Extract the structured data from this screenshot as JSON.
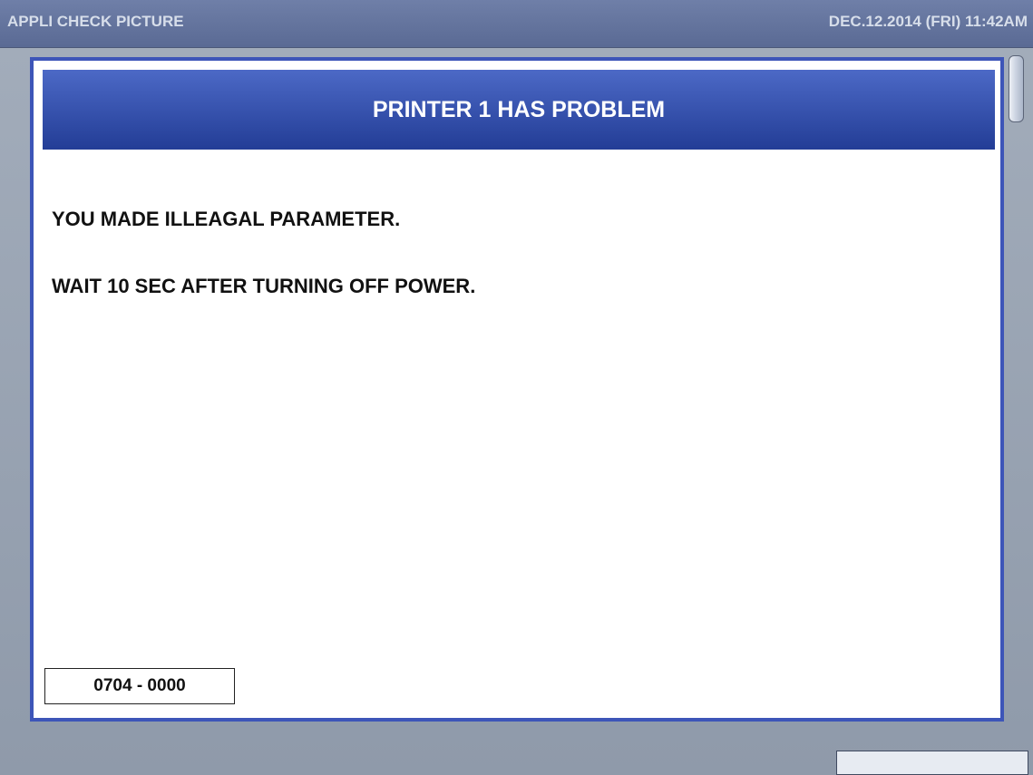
{
  "header": {
    "title": "APPLI CHECK PICTURE",
    "datetime": "DEC.12.2014 (FRI)  11:42AM"
  },
  "dialog": {
    "title": "PRINTER 1 HAS PROBLEM",
    "messages": [
      "YOU MADE ILLEAGAL PARAMETER.",
      "WAIT 10 SEC AFTER TURNING OFF POWER."
    ],
    "error_code": "0704 - 0000"
  },
  "colors": {
    "header_bar": "#5f6f9a",
    "dialog_border": "#3d55b8",
    "dialog_title_bar": "#2f4aa6",
    "background": "#97a2b1"
  }
}
